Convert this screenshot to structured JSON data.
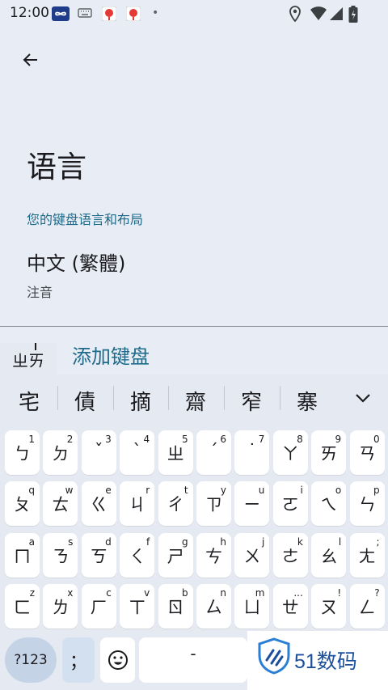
{
  "status_bar": {
    "time": "12:00",
    "dot": "•"
  },
  "page": {
    "title": "语言",
    "section_header": "您的键盘语言和布局",
    "language": {
      "name": "中文 (繁體)",
      "layout": "注音"
    },
    "add_keyboard": "添加键盘"
  },
  "composing": "ㄓㄞ",
  "suggestions": [
    "宅",
    "債",
    "摘",
    "齋",
    "窄",
    "寨"
  ],
  "keyboard": {
    "rows": [
      [
        {
          "g": "ㄅ",
          "h": "1"
        },
        {
          "g": "ㄉ",
          "h": "2"
        },
        {
          "g": "ˇ",
          "h": "3"
        },
        {
          "g": "ˋ",
          "h": "4"
        },
        {
          "g": "ㄓ",
          "h": "5"
        },
        {
          "g": "ˊ",
          "h": "6"
        },
        {
          "g": "˙",
          "h": "7"
        },
        {
          "g": "ㄚ",
          "h": "8"
        },
        {
          "g": "ㄞ",
          "h": "9"
        },
        {
          "g": "ㄢ",
          "h": "0"
        }
      ],
      [
        {
          "g": "ㄆ",
          "h": "q"
        },
        {
          "g": "ㄊ",
          "h": "w"
        },
        {
          "g": "ㄍ",
          "h": "e"
        },
        {
          "g": "ㄐ",
          "h": "r"
        },
        {
          "g": "ㄔ",
          "h": "t"
        },
        {
          "g": "ㄗ",
          "h": "y"
        },
        {
          "g": "ㄧ",
          "h": "u"
        },
        {
          "g": "ㄛ",
          "h": "i"
        },
        {
          "g": "ㄟ",
          "h": "o"
        },
        {
          "g": "ㄣ",
          "h": "p"
        }
      ],
      [
        {
          "g": "ㄇ",
          "h": "a"
        },
        {
          "g": "ㄋ",
          "h": "s"
        },
        {
          "g": "ㄎ",
          "h": "d"
        },
        {
          "g": "ㄑ",
          "h": "f"
        },
        {
          "g": "ㄕ",
          "h": "g"
        },
        {
          "g": "ㄘ",
          "h": "h"
        },
        {
          "g": "ㄨ",
          "h": "j"
        },
        {
          "g": "ㄜ",
          "h": "k"
        },
        {
          "g": "ㄠ",
          "h": "l"
        },
        {
          "g": "ㄤ",
          "h": ";"
        }
      ],
      [
        {
          "g": "ㄈ",
          "h": "z"
        },
        {
          "g": "ㄌ",
          "h": "x"
        },
        {
          "g": "ㄏ",
          "h": "c"
        },
        {
          "g": "ㄒ",
          "h": "v"
        },
        {
          "g": "ㄖ",
          "h": "b"
        },
        {
          "g": "ㄙ",
          "h": "n"
        },
        {
          "g": "ㄩ",
          "h": "m"
        },
        {
          "g": "ㄝ",
          "h": "..."
        },
        {
          "g": "ㄡ",
          "h": "!"
        },
        {
          "g": "ㄥ",
          "h": "?"
        }
      ]
    ],
    "bottom": {
      "symbols_label": "?123",
      "semicolon_label": "；",
      "space_label": "-"
    }
  },
  "watermark": {
    "text": "51数码"
  },
  "colors": {
    "accent": "#1d6a8a",
    "background": "#e8edf5",
    "keyboard_bg": "#e5e9f1"
  }
}
